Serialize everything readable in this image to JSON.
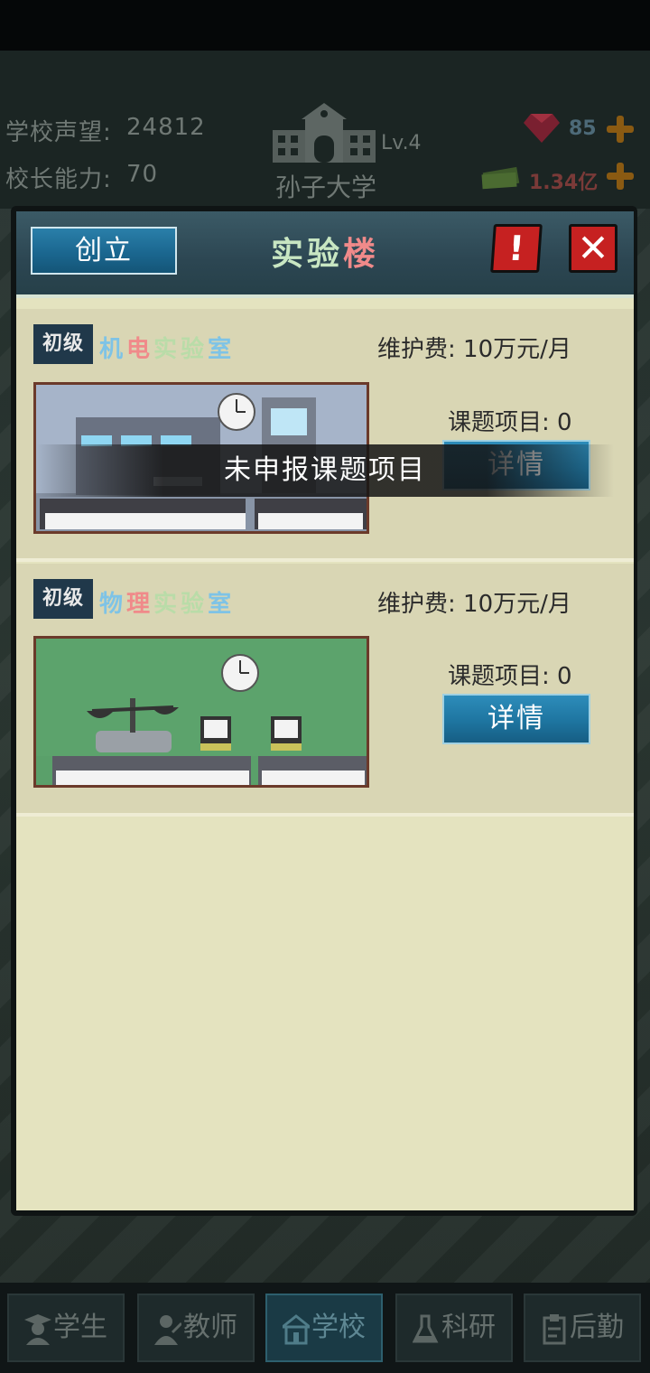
{
  "top": {
    "reputation_label": "学校声望:",
    "reputation_value": "24812",
    "ability_label": "校长能力:",
    "ability_value": "70",
    "school_level": "Lv.4",
    "school_name": "孙子大学",
    "gems": "85",
    "money": "1.34亿"
  },
  "modal": {
    "found_label": "创立",
    "title_part1": "实验",
    "title_part2": "楼",
    "info_label": "!",
    "close_label": "✕"
  },
  "labs": [
    {
      "tag": "初级",
      "name": "机电实验室",
      "fee": "维护费: 10万元/月",
      "projects": "课题项目: 0",
      "detail_label": "详情"
    },
    {
      "tag": "初级",
      "name": "物理实验室",
      "fee": "维护费: 10万元/月",
      "projects": "课题项目: 0",
      "detail_label": "详情"
    }
  ],
  "toast": "未申报课题项目",
  "nav": [
    {
      "label": "学生",
      "icon": "student-icon"
    },
    {
      "label": "教师",
      "icon": "teacher-icon"
    },
    {
      "label": "学校",
      "icon": "school-icon"
    },
    {
      "label": "科研",
      "icon": "flask-icon"
    },
    {
      "label": "后勤",
      "icon": "clipboard-icon"
    }
  ],
  "colors": {
    "title_part1": "#c8e6c2",
    "title_part2": "#f08a8a",
    "lab_name_1": [
      "#7ec3e6",
      "#f08a8a",
      "#b9dca8",
      "#b9dca8",
      "#7ec3e6"
    ],
    "lab_name_2": [
      "#7ec3e6",
      "#f08a8a",
      "#b9dca8",
      "#b9dca8",
      "#7ec3e6"
    ],
    "accent_button": "#1e75a0",
    "panel_bg": "#e4e3bf"
  }
}
